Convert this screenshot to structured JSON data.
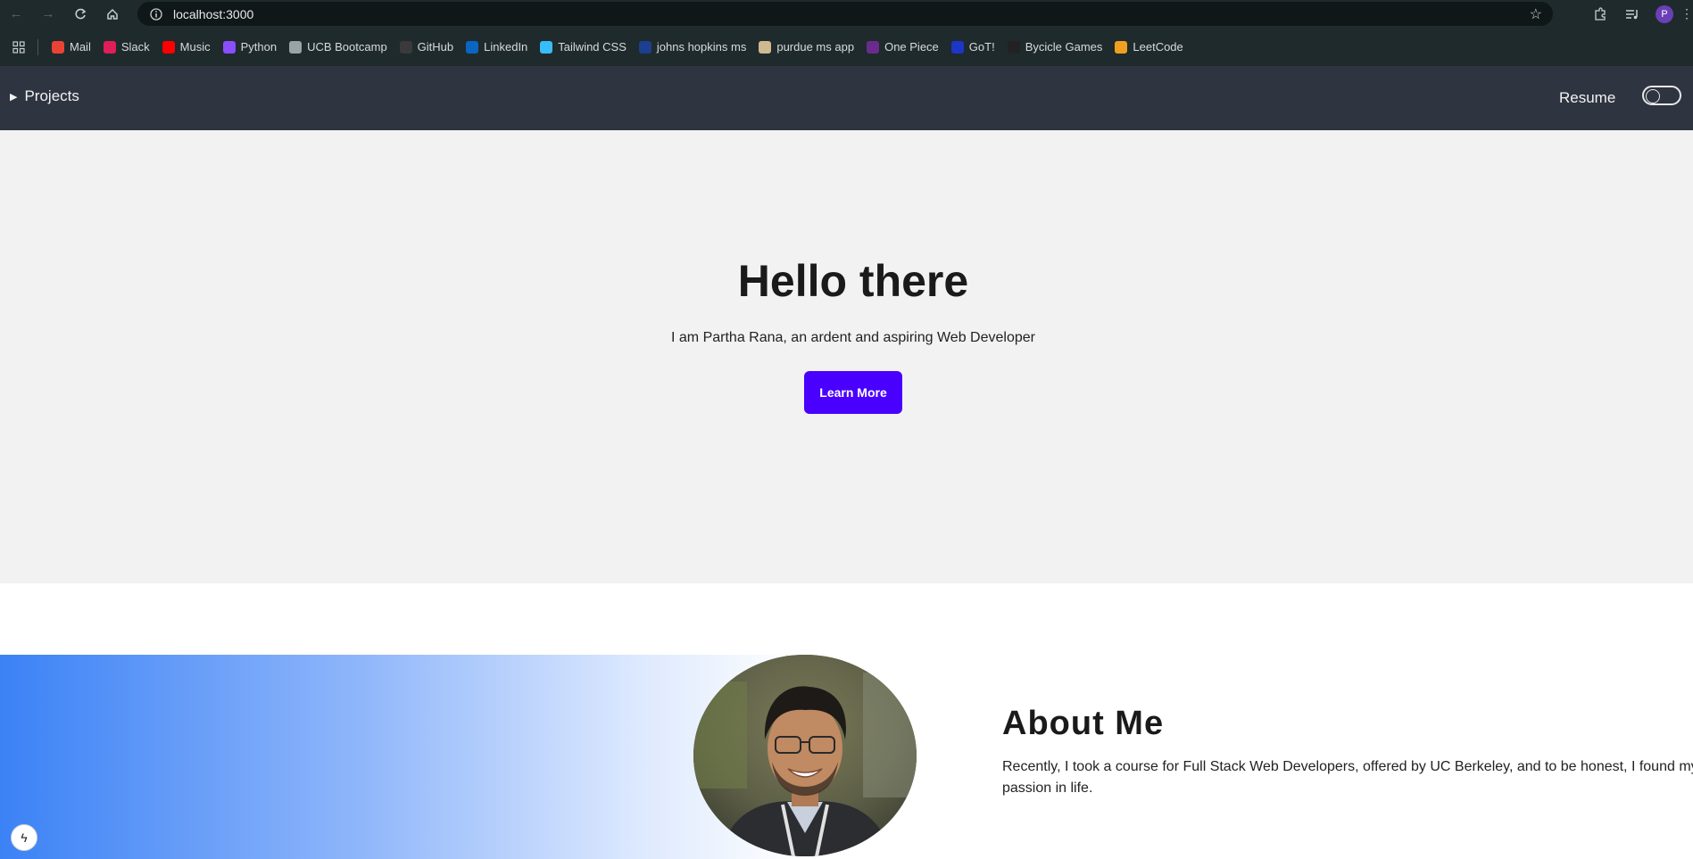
{
  "browser": {
    "url": "localhost:3000",
    "avatar_letter": "P",
    "bookmarks": [
      {
        "label": "Mail",
        "icon": "gmail-icon",
        "color": "#ea4335"
      },
      {
        "label": "Slack",
        "icon": "slack-icon",
        "color": "#e01e5a"
      },
      {
        "label": "Music",
        "icon": "youtube-music-icon",
        "color": "#ff0000"
      },
      {
        "label": "Python",
        "icon": "python-icon",
        "color": "#8a4dff"
      },
      {
        "label": "UCB Bootcamp",
        "icon": "globe-icon",
        "color": "#9aa3a5"
      },
      {
        "label": "GitHub",
        "icon": "github-icon",
        "color": "#3a3a3a"
      },
      {
        "label": "LinkedIn",
        "icon": "linkedin-icon",
        "color": "#0a66c2"
      },
      {
        "label": "Tailwind CSS",
        "icon": "tailwind-icon",
        "color": "#38bdf8"
      },
      {
        "label": "johns hopkins ms",
        "icon": "jhu-shield-icon",
        "color": "#1c3f8f"
      },
      {
        "label": "purdue ms app",
        "icon": "purdue-icon",
        "color": "#cfb991"
      },
      {
        "label": "One Piece",
        "icon": "onepiece-icon",
        "color": "#6a2c8c"
      },
      {
        "label": "GoT!",
        "icon": "got-icon",
        "color": "#1d36c7"
      },
      {
        "label": "Bycicle Games",
        "icon": "spade-icon",
        "color": "#222222"
      },
      {
        "label": "LeetCode",
        "icon": "leetcode-icon",
        "color": "#f0a020"
      }
    ]
  },
  "site_nav": {
    "projects_label": "Projects",
    "resume_label": "Resume"
  },
  "hero": {
    "title": "Hello there",
    "subtitle": "I am Partha Rana, an ardent and aspiring Web Developer",
    "button_label": "Learn More",
    "button_color": "#4a00ff"
  },
  "about": {
    "title": "About Me",
    "text": "Recently, I took a course for Full Stack Web Developers, offered by UC Berkeley, and to be honest, I found my passion in life."
  }
}
